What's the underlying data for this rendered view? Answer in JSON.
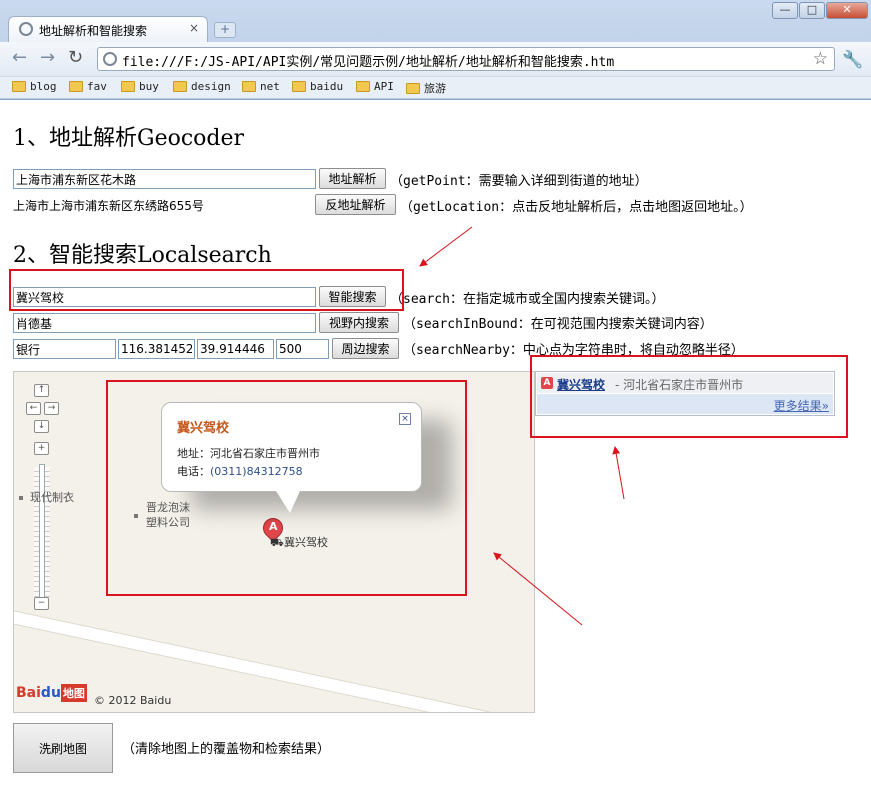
{
  "browser": {
    "tab_title": "地址解析和智能搜索",
    "tab_close": "×",
    "new_tab": "+",
    "window_controls": {
      "minimize": "—",
      "maximize": "□",
      "close": "✕"
    },
    "url": "file:///F:/JS-API/API实例/常见问题示例/地址解析/地址解析和智能搜索.htm",
    "bookmarks": [
      "blog",
      "fav",
      "buy",
      "design",
      "net",
      "baidu",
      "API",
      "旅游"
    ]
  },
  "geocoder": {
    "heading": "1、地址解析Geocoder",
    "address_value": "上海市浦东新区花木路",
    "parse_button": "地址解析",
    "parse_note": "（getPoint：需要输入详细到街道的地址）",
    "reverse_text": "上海市上海市浦东新区东绣路655号",
    "reverse_button": "反地址解析",
    "reverse_note": "（getLocation：点击反地址解析后，点击地图返回地址。）"
  },
  "localsearch": {
    "heading": "2、智能搜索Localsearch",
    "search_value": "冀兴驾校",
    "search_button": "智能搜索",
    "search_note": "（search：在指定城市或全国内搜索关键词。）",
    "bound_value": "肖德基",
    "bound_button": "视野内搜索",
    "bound_note": "（searchInBound：在可视范围内搜索关键词内容）",
    "nearby_keyword": "银行",
    "nearby_lng": "116.381452",
    "nearby_lat": "39.914446",
    "nearby_radius": "500",
    "nearby_button": "周边搜索",
    "nearby_note": "（searchNearby：中心点为字符串时，将自动忽略半径）"
  },
  "map": {
    "controls": {
      "up": "↑",
      "left": "←",
      "right": "→",
      "down": "↓",
      "zoom_in": "+",
      "zoom_out": "−"
    },
    "labels": {
      "factory": "现代制衣",
      "plastics_line1": "晋龙泡沫",
      "plastics_line2": "塑料公司",
      "poi": "冀兴驾校"
    },
    "popup": {
      "title": "冀兴驾校",
      "close": "×",
      "address_label": "地址：",
      "address": "河北省石家庄市晋州市",
      "phone_label": "电话：",
      "phone": "(0311)84312758"
    },
    "marker_letter": "A",
    "logo": {
      "bai": "Bai",
      "du": "du",
      "word": "地图"
    },
    "copyright": "© 2012 Baidu"
  },
  "results": {
    "badge": "A",
    "name": "冀兴驾校",
    "address": " - 河北省石家庄市晋州市",
    "more": "更多结果»"
  },
  "clear": {
    "button": "洗刷地图",
    "note": "（清除地图上的覆盖物和检索结果）"
  },
  "colors": {
    "annotation_red": "#d9141c",
    "popup_title": "#c2561b",
    "result_link": "#1a3c8c"
  }
}
